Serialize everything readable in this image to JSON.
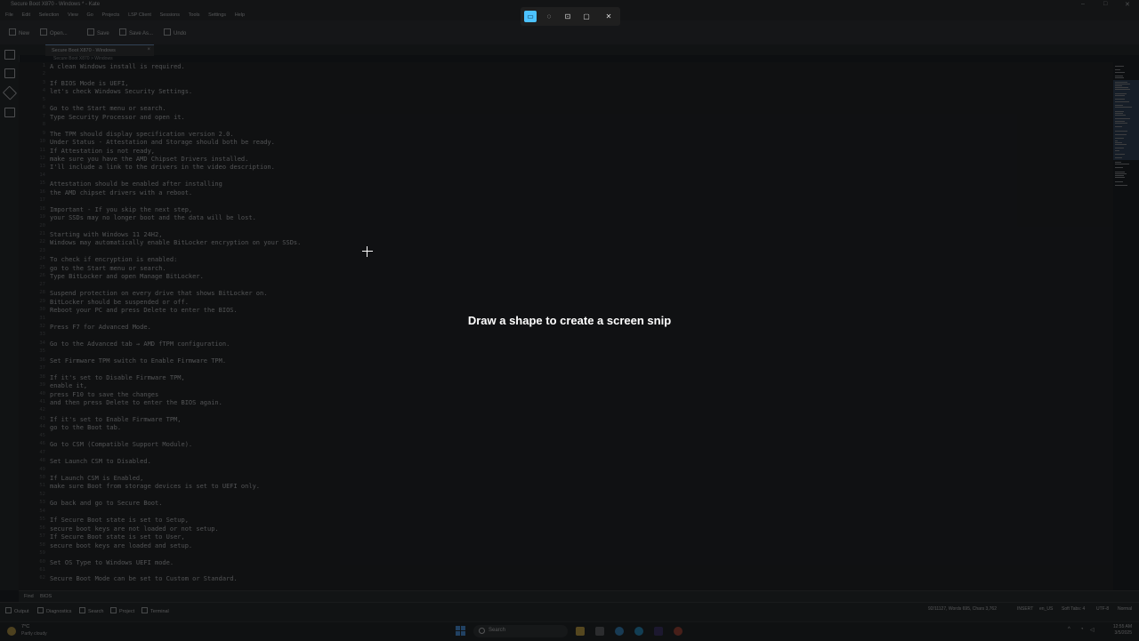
{
  "window": {
    "title": "Secure Boot X870 - Windows * - Kate",
    "controls": [
      "–",
      "□",
      "✕"
    ]
  },
  "menu": [
    "File",
    "Edit",
    "Selection",
    "View",
    "Go",
    "Projects",
    "LSP Client",
    "Sessions",
    "Tools",
    "Settings",
    "Help"
  ],
  "toolbar": {
    "new": "New",
    "open": "Open...",
    "save": "Save",
    "save_as": "Save As...",
    "undo": "Undo"
  },
  "tab": {
    "label": "Secure Boot X870 - Windows",
    "close": "×"
  },
  "breadcrumb": "Secure Boot X870 > Windows",
  "editor": {
    "lines": [
      {
        "n": "1",
        "t": "A clean Windows install is required."
      },
      {
        "n": "2",
        "t": ""
      },
      {
        "n": "3",
        "t": "If BIOS Mode is UEFI,"
      },
      {
        "n": "4",
        "t": "let's check Windows Security Settings."
      },
      {
        "n": "5",
        "t": ""
      },
      {
        "n": "6",
        "t": "Go to the Start menu or search."
      },
      {
        "n": "7",
        "t": "Type Security Processor and open it."
      },
      {
        "n": "8",
        "t": ""
      },
      {
        "n": "9",
        "t": "The TPM should display specification version 2.0."
      },
      {
        "n": "10",
        "t": "Under Status - Attestation and Storage should both be ready."
      },
      {
        "n": "11",
        "t": "If Attestation is not ready,"
      },
      {
        "n": "12",
        "t": "make sure you have the AMD Chipset Drivers installed."
      },
      {
        "n": "13",
        "t": "I'll include a link to the drivers in the video description."
      },
      {
        "n": "14",
        "t": ""
      },
      {
        "n": "15",
        "t": "Attestation should be enabled after installing"
      },
      {
        "n": "16",
        "t": "the AMD chipset drivers with a reboot."
      },
      {
        "n": "17",
        "t": ""
      },
      {
        "n": "18",
        "t": "Important - If you skip the next step,"
      },
      {
        "n": "19",
        "t": "your SSDs may no longer boot and the data will be lost."
      },
      {
        "n": "20",
        "t": ""
      },
      {
        "n": "21",
        "t": "Starting with Windows 11 24H2,"
      },
      {
        "n": "22",
        "t": "Windows may automatically enable BitLocker encryption on your SSDs."
      },
      {
        "n": "23",
        "t": ""
      },
      {
        "n": "24",
        "t": "To check if encryption is enabled:"
      },
      {
        "n": "25",
        "t": "go to the Start menu or search."
      },
      {
        "n": "26",
        "t": "Type BitLocker and open Manage BitLocker."
      },
      {
        "n": "27",
        "t": ""
      },
      {
        "n": "28",
        "t": "Suspend protection on every drive that shows BitLocker on."
      },
      {
        "n": "29",
        "t": "BitLocker should be suspended or off."
      },
      {
        "n": "30",
        "t": "Reboot your PC and press Delete to enter the BIOS."
      },
      {
        "n": "31",
        "t": ""
      },
      {
        "n": "32",
        "t": "Press F7 for Advanced Mode."
      },
      {
        "n": "33",
        "t": ""
      },
      {
        "n": "34",
        "t": "Go to the Advanced tab → AMD fTPM configuration."
      },
      {
        "n": "35",
        "t": ""
      },
      {
        "n": "36",
        "t": "Set Firmware TPM switch to Enable Firmware TPM."
      },
      {
        "n": "37",
        "t": ""
      },
      {
        "n": "38",
        "t": "If it's set to Disable Firmware TPM,"
      },
      {
        "n": "39",
        "t": "enable it,"
      },
      {
        "n": "40",
        "t": "press F10 to save the changes"
      },
      {
        "n": "41",
        "t": "and then press Delete to enter the BIOS again."
      },
      {
        "n": "42",
        "t": ""
      },
      {
        "n": "43",
        "t": "If it's set to Enable Firmware TPM,"
      },
      {
        "n": "44",
        "t": "go to the Boot tab."
      },
      {
        "n": "45",
        "t": ""
      },
      {
        "n": "46",
        "t": "Go to CSM (Compatible Support Module)."
      },
      {
        "n": "47",
        "t": ""
      },
      {
        "n": "48",
        "t": "Set Launch CSM to Disabled."
      },
      {
        "n": "49",
        "t": ""
      },
      {
        "n": "50",
        "t": "If Launch CSM is Enabled,"
      },
      {
        "n": "51",
        "t": "make sure Boot from storage devices is set to UEFI only."
      },
      {
        "n": "52",
        "t": ""
      },
      {
        "n": "53",
        "t": "Go back and go to Secure Boot."
      },
      {
        "n": "54",
        "t": ""
      },
      {
        "n": "55",
        "t": "If Secure Boot state is set to Setup,"
      },
      {
        "n": "56",
        "t": "secure boot keys are not loaded or not setup."
      },
      {
        "n": "57",
        "t": "If Secure Boot state is set to User,"
      },
      {
        "n": "58",
        "t": "secure boot keys are loaded and setup."
      },
      {
        "n": "59",
        "t": ""
      },
      {
        "n": "60",
        "t": "Set OS Type to Windows UEFI mode."
      },
      {
        "n": "61",
        "t": ""
      },
      {
        "n": "62",
        "t": "Secure Boot Mode can be set to Custom or Standard."
      }
    ]
  },
  "find": {
    "label": "Find",
    "value": "BIOS"
  },
  "bottom_tabs": [
    "Output",
    "Diagnostics",
    "Search",
    "Project",
    "Terminal"
  ],
  "status": {
    "position": "92/11127, Words 695, Chars 3,762",
    "mode": "INSERT",
    "lang": "en_US",
    "tabs": "Soft Tabs: 4",
    "encoding": "UTF-8",
    "syntax": "Normal"
  },
  "taskbar": {
    "temp": "7°C",
    "condition": "Partly cloudy",
    "search_placeholder": "Search",
    "time": "12:55 AM",
    "date": "3/5/2025"
  },
  "snip": {
    "message": "Draw a shape to create a screen snip",
    "modes": [
      "rectangle-mode",
      "freeform-mode",
      "window-mode",
      "fullscreen-mode"
    ],
    "accent": "#4cc2ff"
  }
}
